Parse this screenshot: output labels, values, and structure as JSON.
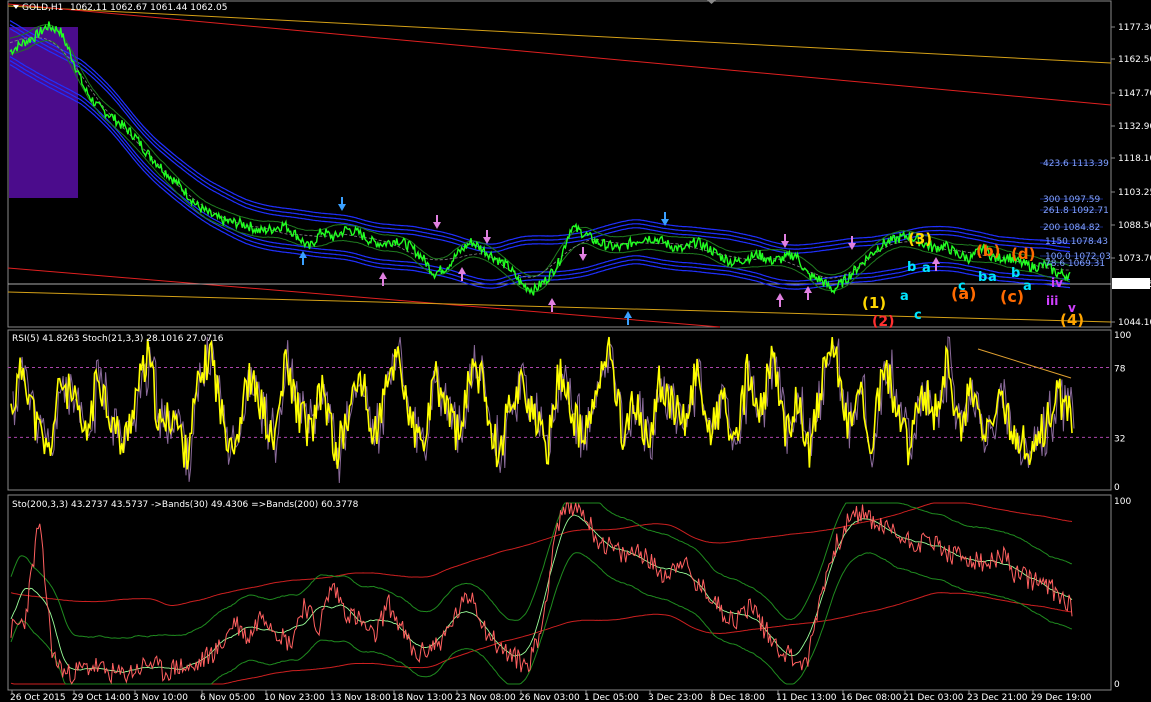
{
  "header": {
    "symbol": "GOLD,H1",
    "ohlc": "1062.11 1062.67 1061.44 1062.05"
  },
  "price_axis": {
    "ticks": [
      "1177.30",
      "1162.50",
      "1147.70",
      "1132.90",
      "1118.10",
      "1103.25",
      "1088.50",
      "1073.70",
      "1044.10"
    ],
    "current": "1062.05"
  },
  "fib_levels": [
    {
      "label": "423.6 1113.39"
    },
    {
      "label": "300 1097.59"
    },
    {
      "label": "261.8 1092.71"
    },
    {
      "label": "200 1084.82"
    },
    {
      "label": "1150 1078.43"
    },
    {
      "label": "100.0 1072.03"
    },
    {
      "label": "78.6 1069.31"
    }
  ],
  "wave_labels": [
    {
      "text": "(1)",
      "color": "#ffd700"
    },
    {
      "text": "(2)",
      "color": "#ff3030"
    },
    {
      "text": "(3)",
      "color": "#ffd700"
    },
    {
      "text": "(4)",
      "color": "#ffa500"
    },
    {
      "text": "(a)",
      "color": "#ff6a00"
    },
    {
      "text": "(b)",
      "color": "#ff6a00"
    },
    {
      "text": "(c)",
      "color": "#ff6a00"
    },
    {
      "text": "(d)",
      "color": "#ff6a00"
    },
    {
      "text": "a",
      "color": "#00e5ff"
    },
    {
      "text": "b",
      "color": "#00e5ff"
    },
    {
      "text": "c",
      "color": "#00e5ff"
    },
    {
      "text": "iii",
      "color": "#d040ff"
    },
    {
      "text": "iv",
      "color": "#d040ff"
    },
    {
      "text": "v",
      "color": "#d040ff"
    }
  ],
  "rsi_panel": {
    "label": "RSI(5) 41.8263  Stoch(21,3,3) 28.1016 27.0716",
    "ticks": [
      "100",
      "78",
      "32",
      "0"
    ]
  },
  "sto_panel": {
    "label": "Sto(200,3,3) 43.2737 43.5737   ->Bands(30) 49.4306   =>Bands(200) 60.3778",
    "ticks": [
      "100",
      "0"
    ]
  },
  "time_axis": [
    "26 Oct 2015",
    "29 Oct 14:00",
    "3 Nov 10:00",
    "6 Nov 05:00",
    "10 Nov 23:00",
    "13 Nov 18:00",
    "18 Nov 13:00",
    "23 Nov 08:00",
    "26 Nov 03:00",
    "1 Dec 05:00",
    "3 Dec 23:00",
    "8 Dec 18:00",
    "11 Dec 13:00",
    "16 Dec 08:00",
    "21 Dec 03:00",
    "23 Dec 21:00",
    "29 Dec 19:00"
  ],
  "colors": {
    "price": "#22ff22",
    "envelope": "#2030ff",
    "rsi": "#ffff00",
    "stoch": "#8a6a9a",
    "bands": "#cc2020",
    "sto": "#ff6060"
  },
  "chart_data": [
    {
      "type": "line",
      "title": "GOLD,H1",
      "ylim": [
        1040,
        1190
      ],
      "series": [
        {
          "name": "GOLD,H1",
          "values": [
            1168,
            1172,
            1175,
            1180,
            1178,
            1165,
            1150,
            1142,
            1138,
            1133,
            1128,
            1120,
            1114,
            1108,
            1102,
            1095,
            1091,
            1088,
            1087,
            1086,
            1083,
            1084,
            1086,
            1081,
            1075,
            1083,
            1080,
            1084,
            1082,
            1078,
            1077,
            1079,
            1076,
            1071,
            1063,
            1066,
            1073,
            1078,
            1074,
            1070,
            1066,
            1058,
            1055,
            1060,
            1068,
            1085,
            1082,
            1078,
            1076,
            1075,
            1078,
            1080,
            1079,
            1076,
            1074,
            1078,
            1075,
            1071,
            1068,
            1070,
            1072,
            1069,
            1070,
            1072,
            1062,
            1060,
            1055,
            1060,
            1066,
            1072,
            1077,
            1079,
            1081,
            1078,
            1075,
            1076,
            1072,
            1070,
            1075,
            1070,
            1071,
            1068,
            1066,
            1067,
            1063,
            1062
          ]
        }
      ]
    },
    {
      "type": "line",
      "ylim": [
        0,
        100
      ],
      "series": [
        {
          "name": "RSI(5)",
          "values": [
            50,
            80,
            40,
            20,
            70,
            55,
            30,
            75,
            45,
            25,
            60,
            85,
            35,
            50,
            20,
            65,
            90,
            40,
            30,
            70,
            55,
            25,
            80,
            50,
            35,
            65,
            20,
            45,
            75,
            30,
            60,
            90,
            40,
            25,
            70,
            50,
            30,
            85,
            60,
            20,
            55,
            70,
            40,
            25,
            80,
            45,
            30,
            65,
            90,
            35,
            55,
            25,
            70,
            50,
            40,
            80,
            30,
            60,
            20,
            75,
            45,
            85,
            35,
            55,
            25,
            70,
            90,
            40,
            60,
            30,
            80,
            50,
            20,
            65,
            45,
            85,
            35,
            70,
            25,
            55,
            40,
            30,
            20,
            45,
            60,
            41.8
          ]
        }
      ]
    },
    {
      "type": "line",
      "ylim": [
        0,
        100
      ],
      "series": [
        {
          "name": "Sto(200,3,3)",
          "values": [
            30,
            35,
            90,
            15,
            5,
            8,
            10,
            6,
            5,
            8,
            12,
            6,
            10,
            8,
            15,
            20,
            35,
            25,
            40,
            30,
            22,
            45,
            30,
            55,
            40,
            35,
            25,
            45,
            30,
            15,
            20,
            25,
            40,
            50,
            30,
            20,
            15,
            10,
            30,
            85,
            100,
            95,
            80,
            75,
            70,
            75,
            65,
            60,
            70,
            55,
            50,
            40,
            35,
            45,
            30,
            20,
            15,
            10,
            50,
            75,
            90,
            95,
            88,
            85,
            80,
            78,
            80,
            72,
            70,
            68,
            65,
            72,
            60,
            58,
            55,
            50,
            43.3
          ]
        }
      ]
    }
  ]
}
